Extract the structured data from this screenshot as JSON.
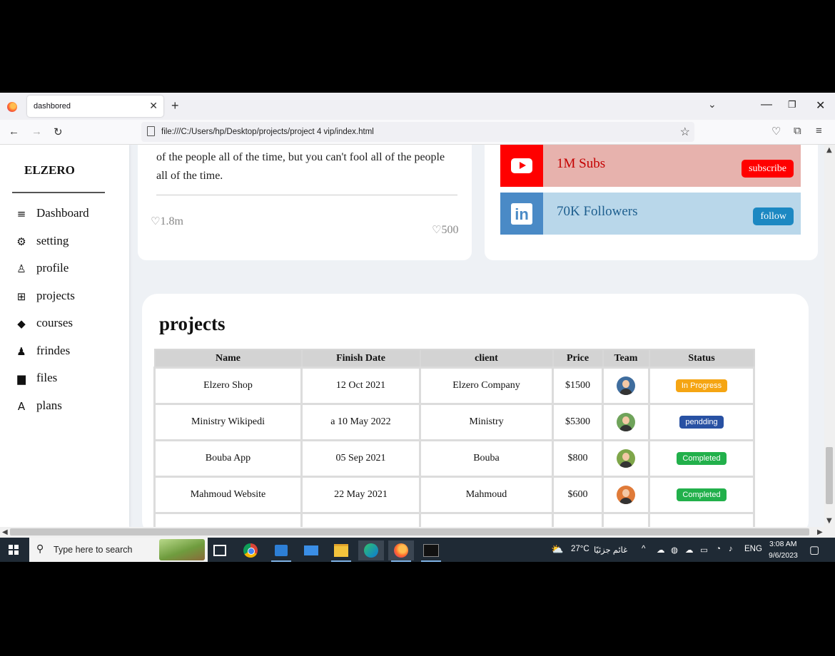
{
  "browser": {
    "tab_title": "dashbored",
    "url": "file:///C:/Users/hp/Desktop/projects/project 4 vip/index.html"
  },
  "sidebar": {
    "brand": "ELZERO",
    "items": [
      {
        "label": "Dashboard",
        "icon": "dashboard-icon"
      },
      {
        "label": "setting",
        "icon": "gear-icon"
      },
      {
        "label": "profile",
        "icon": "user-icon"
      },
      {
        "label": "projects",
        "icon": "sitemap-icon"
      },
      {
        "label": "courses",
        "icon": "graduation-cap-icon"
      },
      {
        "label": "frindes",
        "icon": "friends-icon"
      },
      {
        "label": "files",
        "icon": "file-icon"
      },
      {
        "label": "plans",
        "icon": "plans-icon"
      }
    ]
  },
  "quote_card": {
    "text": "of the people all of the time, but you can't fool all of the people all of the time.",
    "likes_left": "1.8m",
    "likes_right": "500"
  },
  "social": {
    "youtube": {
      "text": "1M Subs",
      "button": "subscribe"
    },
    "linkedin": {
      "text": "70K Followers",
      "button": "follow"
    }
  },
  "projects": {
    "title": "projects",
    "columns": [
      "Name",
      "Finish Date",
      "client",
      "Price",
      "Team",
      "Status"
    ],
    "rows": [
      {
        "name": "Elzero Shop",
        "date": "12 Oct 2021",
        "client": "Elzero Company",
        "price": "$1500",
        "status": "In Progress",
        "status_color": "#f5a513",
        "avatar_color": "#3f6d9e"
      },
      {
        "name": "Ministry Wikipedi",
        "date": "a 10 May 2022",
        "client": "Ministry",
        "price": "$5300",
        "status": "pendding",
        "status_color": "#2851a3",
        "avatar_color": "#6fa35a"
      },
      {
        "name": "Bouba App",
        "date": "05 Sep 2021",
        "client": "Bouba",
        "price": "$800",
        "status": "Completed",
        "status_color": "#22b04b",
        "avatar_color": "#7fa64a"
      },
      {
        "name": "Mahmoud Website",
        "date": "22 May 2021",
        "client": "Mahmoud",
        "price": "$600",
        "status": "Completed",
        "status_color": "#22b04b",
        "avatar_color": "#e07b39"
      }
    ]
  },
  "taskbar": {
    "search_placeholder": "Type here to search",
    "weather": "27°C",
    "weather_text": "غائم جزئيًا",
    "language": "ENG",
    "time": "3:08 AM",
    "date": "9/6/2023"
  }
}
